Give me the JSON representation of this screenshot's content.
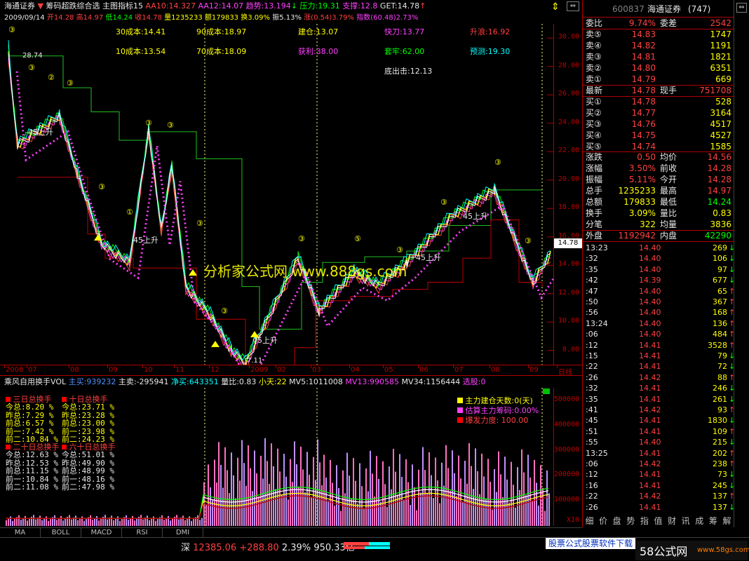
{
  "header": {
    "stock_name": "海通证券",
    "indicator_name": "筹码超跌综合选",
    "main_indicator": "主图指标15",
    "aa10": "AA10:14.327",
    "aa12": "AA12:14.07",
    "trend": "趋势:13.194",
    "pressure": "压力:19.31",
    "support": "支撑:12.8",
    "get": "GET:14.78"
  },
  "ohlc": {
    "date": "2009/09/14",
    "open": "开14.28",
    "high": "高14.97",
    "low": "低14.24",
    "close": "收14.78",
    "volume": "量1235233",
    "amount": "额179833",
    "turnover": "换3.09%",
    "amplitude": "振5.13%",
    "change": "涨(0.54)3.79%",
    "index": "指数(60.48)2.73%"
  },
  "chart_labels": {
    "cost30": "30成本:14.41",
    "cost90": "90成本:18.97",
    "build": "建仓:13.07",
    "fast_knife": "快刀:13.77",
    "rise_stop": "升浪:16.92",
    "cost10": "10成本:13.54",
    "cost70": "70成本:18.09",
    "profit": "获利:38.00",
    "trapped": "套牢:62.00",
    "forecast": "预测:19.30",
    "bottom_out": "底出击:12.13",
    "peak_label": "28.74",
    "low_label": "7.11",
    "watermark": "分析家公式网 www.888gs.com",
    "rise45": "45上升",
    "current_price_tag": "14.78"
  },
  "y_axis": [
    "30.00",
    "28.00",
    "26.00",
    "24.00",
    "22.00",
    "20.00",
    "18.00",
    "16.00",
    "14.00",
    "12.00",
    "10.00",
    "8.00"
  ],
  "x_axis": [
    "2008",
    "07",
    "08",
    "09",
    "10",
    "11",
    "12",
    "2009",
    "02",
    "03",
    "04",
    "05",
    "06",
    "07",
    "08",
    "09",
    "日线"
  ],
  "indicator": {
    "name": "乘风自用换手VOL",
    "main_buy": "主买:939232",
    "main_sell": "主卖:-295941",
    "net_buy": "净买:643351",
    "vol_ratio": "量比:0.83",
    "small_day": "小天:22",
    "mv5": "MV5:1011008",
    "mv13": "MV13:990585",
    "mv34": "MV34:1156444",
    "select": "选股:0"
  },
  "turnover_boxes": {
    "three_day_title": "三日总换手",
    "three_day": [
      "今总:8.20 %",
      "昨总:7.29 %",
      "前总:6.57 %",
      "前一:7.42 %",
      "前二:10.84 %"
    ],
    "ten_day_title": "十日总换手",
    "ten_day": [
      "今总:23.71 %",
      "昨总:23.28 %",
      "前总:23.00 %",
      "前一:23.98 %",
      "前二:24.23 %"
    ],
    "twenty_day_title": "二十日总换手",
    "twenty_day": [
      "今总:12.63 %",
      "昨总:12.53 %",
      "前总:11.15 %",
      "前一:10.84 %",
      "前二:11.08 %"
    ],
    "sixty_day_title": "六十日总换手",
    "sixty_day": [
      "今总:51.01 %",
      "昨总:49.90 %",
      "前总:48.99 %",
      "前一:48.16 %",
      "前二:47.98 %"
    ]
  },
  "legend": {
    "days": "主力建仓天数:0(天)",
    "estimate": "估算主力筹码:0.00%",
    "burst": "爆发力度: 100.00"
  },
  "vol_axis": [
    "500000",
    "400000",
    "300000",
    "200000",
    "100000",
    "X10"
  ],
  "tabs": [
    "MA",
    "BOLL",
    "MACD",
    "RSI",
    "DMI"
  ],
  "status": {
    "market": "深",
    "index_value": "12385.06",
    "change": "+288.80",
    "pct": "2.39%",
    "amount": "950.33亿",
    "ad_text": "股票公式股票软件下载",
    "site": "58公式网",
    "site_url": "www.58gs.com"
  },
  "quote": {
    "code": "600837",
    "name": "海通证券",
    "number": "(747)",
    "weibi_label": "委比",
    "weibi": "9.74%",
    "weicha_label": "委差",
    "weicha": "2542",
    "asks": [
      {
        "label": "卖⑤",
        "price": "14.83",
        "vol": "1747"
      },
      {
        "label": "卖④",
        "price": "14.82",
        "vol": "1191"
      },
      {
        "label": "卖③",
        "price": "14.81",
        "vol": "1821"
      },
      {
        "label": "卖②",
        "price": "14.80",
        "vol": "6351"
      },
      {
        "label": "卖①",
        "price": "14.79",
        "vol": "669"
      }
    ],
    "last_label": "最新",
    "last": "14.78",
    "now_vol_label": "现手",
    "now_vol": "751708",
    "bids": [
      {
        "label": "买①",
        "price": "14.78",
        "vol": "528"
      },
      {
        "label": "买②",
        "price": "14.77",
        "vol": "3164"
      },
      {
        "label": "买③",
        "price": "14.76",
        "vol": "4517"
      },
      {
        "label": "买④",
        "price": "14.75",
        "vol": "4527"
      },
      {
        "label": "买⑤",
        "price": "14.74",
        "vol": "1585"
      }
    ],
    "stats": [
      [
        "涨跌",
        "0.50",
        "均价",
        "14.56"
      ],
      [
        "涨幅",
        "3.50%",
        "前收",
        "14.28"
      ],
      [
        "振幅",
        "5.11%",
        "今开",
        "14.28"
      ],
      [
        "总手",
        "1235233",
        "最高",
        "14.97"
      ],
      [
        "总额",
        "179833",
        "最低",
        "14.24"
      ],
      [
        "换手",
        "3.09%",
        "量比",
        "0.83"
      ],
      [
        "分笔",
        "322",
        "均量",
        "3836"
      ]
    ],
    "outer_label": "外盘",
    "outer": "1192942",
    "inner_label": "内盘",
    "inner": "42290"
  },
  "ticks": [
    {
      "t": "13:23",
      "p": "14.40",
      "v": "269",
      "d": "dn"
    },
    {
      "t": ":32",
      "p": "14.40",
      "v": "106",
      "d": "dn"
    },
    {
      "t": ":35",
      "p": "14.40",
      "v": "97",
      "d": "dn"
    },
    {
      "t": ":42",
      "p": "14.39",
      "v": "677",
      "d": "dn"
    },
    {
      "t": ":47",
      "p": "14.40",
      "v": "65",
      "d": "up"
    },
    {
      "t": ":50",
      "p": "14.40",
      "v": "367",
      "d": "up"
    },
    {
      "t": ":56",
      "p": "14.40",
      "v": "168",
      "d": "up"
    },
    {
      "t": "13:24",
      "p": "14.40",
      "v": "136",
      "d": "up"
    },
    {
      "t": ":06",
      "p": "14.40",
      "v": "484",
      "d": "up"
    },
    {
      "t": ":12",
      "p": "14.41",
      "v": "3528",
      "d": "up"
    },
    {
      "t": ":15",
      "p": "14.41",
      "v": "79",
      "d": "dn"
    },
    {
      "t": ":22",
      "p": "14.41",
      "v": "72",
      "d": "dn"
    },
    {
      "t": ":26",
      "p": "14.42",
      "v": "88",
      "d": "up"
    },
    {
      "t": ":32",
      "p": "14.41",
      "v": "246",
      "d": "dn"
    },
    {
      "t": ":35",
      "p": "14.41",
      "v": "261",
      "d": "dn"
    },
    {
      "t": ":41",
      "p": "14.42",
      "v": "93",
      "d": "up"
    },
    {
      "t": ":45",
      "p": "14.41",
      "v": "1830",
      "d": "dn"
    },
    {
      "t": ":51",
      "p": "14.41",
      "v": "109",
      "d": "up"
    },
    {
      "t": ":55",
      "p": "14.40",
      "v": "215",
      "d": "dn"
    },
    {
      "t": "13:25",
      "p": "14.41",
      "v": "202",
      "d": "up"
    },
    {
      "t": ":06",
      "p": "14.42",
      "v": "238",
      "d": "up"
    },
    {
      "t": ":12",
      "p": "14.41",
      "v": "73",
      "d": "dn"
    },
    {
      "t": ":16",
      "p": "14.41",
      "v": "245",
      "d": "dn"
    },
    {
      "t": ":22",
      "p": "14.42",
      "v": "137",
      "d": "up"
    },
    {
      "t": ":26",
      "p": "14.41",
      "v": "137",
      "d": "dn"
    }
  ],
  "bottom_tabs": [
    "细",
    "价",
    "盘",
    "势",
    "指",
    "值",
    "财",
    "讯",
    "成",
    "筹",
    "解"
  ],
  "chart_data": {
    "type": "candlestick",
    "title": "",
    "ylim": [
      7,
      31
    ],
    "price_path": [
      {
        "x": "2008-07",
        "y": 28.74
      },
      {
        "x": "2008-07",
        "y": 22.5
      },
      {
        "x": "2008-08",
        "y": 24.5
      },
      {
        "x": "2008-08",
        "y": 20.5
      },
      {
        "x": "2008-09",
        "y": 15.5
      },
      {
        "x": "2008-09",
        "y": 14.2
      },
      {
        "x": "2008-10",
        "y": 23.5
      },
      {
        "x": "2008-10",
        "y": 16.5
      },
      {
        "x": "2008-11",
        "y": 21.0
      },
      {
        "x": "2008-11",
        "y": 12.5
      },
      {
        "x": "2008-12",
        "y": 10.5
      },
      {
        "x": "2008-12",
        "y": 8.0
      },
      {
        "x": "2009-01",
        "y": 7.11
      },
      {
        "x": "2009-02",
        "y": 14.5
      },
      {
        "x": "2009-03",
        "y": 10.8
      },
      {
        "x": "2009-04",
        "y": 13.5
      },
      {
        "x": "2009-05",
        "y": 12.6
      },
      {
        "x": "2009-06",
        "y": 14.2
      },
      {
        "x": "2009-07",
        "y": 17.5
      },
      {
        "x": "2009-08",
        "y": 19.3
      },
      {
        "x": "2009-09",
        "y": 12.8
      },
      {
        "x": "2009-09",
        "y": 14.78
      }
    ]
  }
}
